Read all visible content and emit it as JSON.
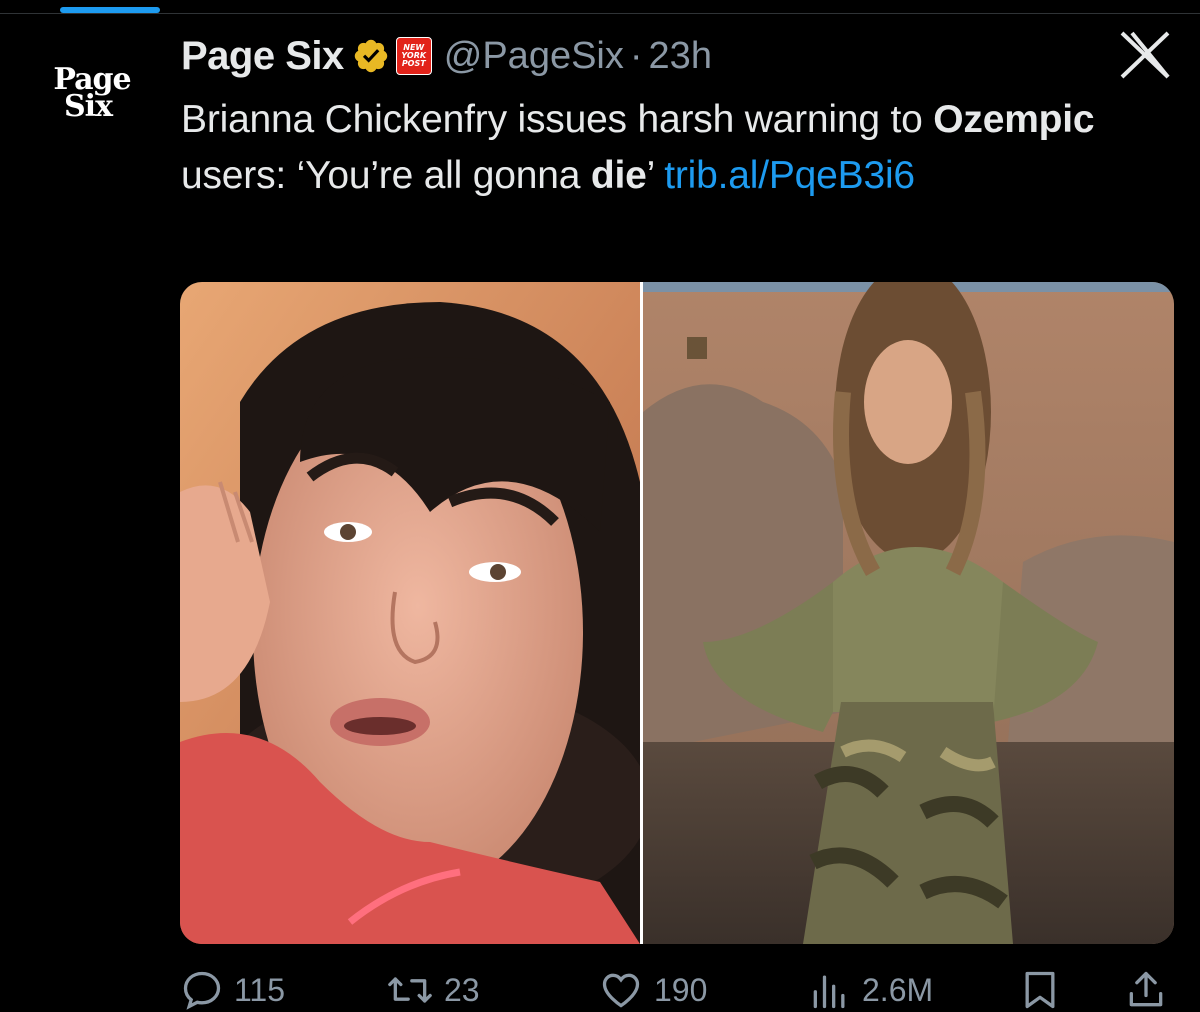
{
  "avatar": {
    "line1": "Page",
    "line2": "Six"
  },
  "tweet": {
    "display_name": "Page Six",
    "badge": {
      "line1": "NEW",
      "line2": "YORK",
      "line3": "POST"
    },
    "handle": "@PageSix",
    "separator": "·",
    "time": "23h",
    "text": {
      "part1": "Brianna Chickenfry issues harsh warning to ",
      "bold1": "Ozempic",
      "part2": " users: ‘You’re all gonna ",
      "bold2": "die",
      "part3": "’ ",
      "link": "trib.al/PqeB3i6"
    }
  },
  "media": {
    "left_alt": "Woman with dark hair filming a selfie video lying down",
    "right_alt": "Woman with long hair wearing olive top and camo pants standing by ruins"
  },
  "actions": {
    "replies": "115",
    "retweets": "23",
    "likes": "190",
    "views": "2.6M"
  },
  "colors": {
    "background": "#000000",
    "text": "#e7e9ea",
    "muted": "#8b98a5",
    "link": "#1d9bf0",
    "verified": "#e8b824",
    "nyp_red": "#e2231a"
  }
}
